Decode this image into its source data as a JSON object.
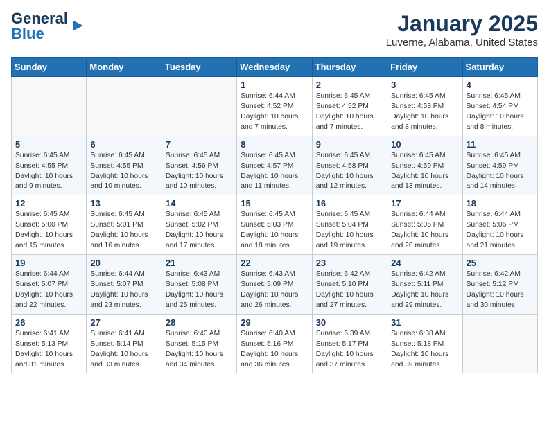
{
  "header": {
    "logo_general": "General",
    "logo_blue": "Blue",
    "title": "January 2025",
    "subtitle": "Luverne, Alabama, United States"
  },
  "days_of_week": [
    "Sunday",
    "Monday",
    "Tuesday",
    "Wednesday",
    "Thursday",
    "Friday",
    "Saturday"
  ],
  "weeks": [
    [
      {
        "num": "",
        "info": ""
      },
      {
        "num": "",
        "info": ""
      },
      {
        "num": "",
        "info": ""
      },
      {
        "num": "1",
        "info": "Sunrise: 6:44 AM\nSunset: 4:52 PM\nDaylight: 10 hours\nand 7 minutes."
      },
      {
        "num": "2",
        "info": "Sunrise: 6:45 AM\nSunset: 4:52 PM\nDaylight: 10 hours\nand 7 minutes."
      },
      {
        "num": "3",
        "info": "Sunrise: 6:45 AM\nSunset: 4:53 PM\nDaylight: 10 hours\nand 8 minutes."
      },
      {
        "num": "4",
        "info": "Sunrise: 6:45 AM\nSunset: 4:54 PM\nDaylight: 10 hours\nand 8 minutes."
      }
    ],
    [
      {
        "num": "5",
        "info": "Sunrise: 6:45 AM\nSunset: 4:55 PM\nDaylight: 10 hours\nand 9 minutes."
      },
      {
        "num": "6",
        "info": "Sunrise: 6:45 AM\nSunset: 4:55 PM\nDaylight: 10 hours\nand 10 minutes."
      },
      {
        "num": "7",
        "info": "Sunrise: 6:45 AM\nSunset: 4:56 PM\nDaylight: 10 hours\nand 10 minutes."
      },
      {
        "num": "8",
        "info": "Sunrise: 6:45 AM\nSunset: 4:57 PM\nDaylight: 10 hours\nand 11 minutes."
      },
      {
        "num": "9",
        "info": "Sunrise: 6:45 AM\nSunset: 4:58 PM\nDaylight: 10 hours\nand 12 minutes."
      },
      {
        "num": "10",
        "info": "Sunrise: 6:45 AM\nSunset: 4:59 PM\nDaylight: 10 hours\nand 13 minutes."
      },
      {
        "num": "11",
        "info": "Sunrise: 6:45 AM\nSunset: 4:59 PM\nDaylight: 10 hours\nand 14 minutes."
      }
    ],
    [
      {
        "num": "12",
        "info": "Sunrise: 6:45 AM\nSunset: 5:00 PM\nDaylight: 10 hours\nand 15 minutes."
      },
      {
        "num": "13",
        "info": "Sunrise: 6:45 AM\nSunset: 5:01 PM\nDaylight: 10 hours\nand 16 minutes."
      },
      {
        "num": "14",
        "info": "Sunrise: 6:45 AM\nSunset: 5:02 PM\nDaylight: 10 hours\nand 17 minutes."
      },
      {
        "num": "15",
        "info": "Sunrise: 6:45 AM\nSunset: 5:03 PM\nDaylight: 10 hours\nand 18 minutes."
      },
      {
        "num": "16",
        "info": "Sunrise: 6:45 AM\nSunset: 5:04 PM\nDaylight: 10 hours\nand 19 minutes."
      },
      {
        "num": "17",
        "info": "Sunrise: 6:44 AM\nSunset: 5:05 PM\nDaylight: 10 hours\nand 20 minutes."
      },
      {
        "num": "18",
        "info": "Sunrise: 6:44 AM\nSunset: 5:06 PM\nDaylight: 10 hours\nand 21 minutes."
      }
    ],
    [
      {
        "num": "19",
        "info": "Sunrise: 6:44 AM\nSunset: 5:07 PM\nDaylight: 10 hours\nand 22 minutes."
      },
      {
        "num": "20",
        "info": "Sunrise: 6:44 AM\nSunset: 5:07 PM\nDaylight: 10 hours\nand 23 minutes."
      },
      {
        "num": "21",
        "info": "Sunrise: 6:43 AM\nSunset: 5:08 PM\nDaylight: 10 hours\nand 25 minutes."
      },
      {
        "num": "22",
        "info": "Sunrise: 6:43 AM\nSunset: 5:09 PM\nDaylight: 10 hours\nand 26 minutes."
      },
      {
        "num": "23",
        "info": "Sunrise: 6:42 AM\nSunset: 5:10 PM\nDaylight: 10 hours\nand 27 minutes."
      },
      {
        "num": "24",
        "info": "Sunrise: 6:42 AM\nSunset: 5:11 PM\nDaylight: 10 hours\nand 29 minutes."
      },
      {
        "num": "25",
        "info": "Sunrise: 6:42 AM\nSunset: 5:12 PM\nDaylight: 10 hours\nand 30 minutes."
      }
    ],
    [
      {
        "num": "26",
        "info": "Sunrise: 6:41 AM\nSunset: 5:13 PM\nDaylight: 10 hours\nand 31 minutes."
      },
      {
        "num": "27",
        "info": "Sunrise: 6:41 AM\nSunset: 5:14 PM\nDaylight: 10 hours\nand 33 minutes."
      },
      {
        "num": "28",
        "info": "Sunrise: 6:40 AM\nSunset: 5:15 PM\nDaylight: 10 hours\nand 34 minutes."
      },
      {
        "num": "29",
        "info": "Sunrise: 6:40 AM\nSunset: 5:16 PM\nDaylight: 10 hours\nand 36 minutes."
      },
      {
        "num": "30",
        "info": "Sunrise: 6:39 AM\nSunset: 5:17 PM\nDaylight: 10 hours\nand 37 minutes."
      },
      {
        "num": "31",
        "info": "Sunrise: 6:38 AM\nSunset: 5:18 PM\nDaylight: 10 hours\nand 39 minutes."
      },
      {
        "num": "",
        "info": ""
      }
    ]
  ]
}
